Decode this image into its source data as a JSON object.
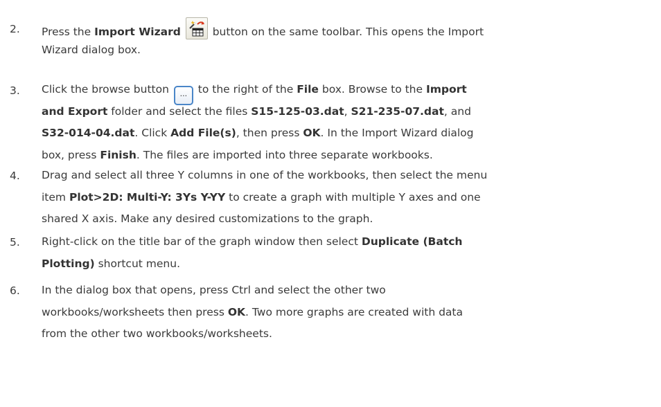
{
  "steps": [
    {
      "number": "2.",
      "line1": {
        "t1": "Press the ",
        "b1": "Import Wizard",
        "t2": " button on the same toolbar. This opens the Import"
      },
      "line2": {
        "t1": "Wizard dialog box."
      },
      "icon": "import-wizard-icon"
    },
    {
      "number": "3.",
      "line1": {
        "t1": "Click the browse button ",
        "t2": " to the right of the ",
        "b1": "File",
        "t3": " box. Browse to the ",
        "b2": "Import"
      },
      "line2": {
        "b1": "and Export",
        "t1": " folder and select the files ",
        "b2": "S15-125-03.dat",
        "t2": ", ",
        "b3": "S21-235-07.dat",
        "t3": ", and"
      },
      "line3": {
        "b1": "S32-014-04.dat",
        "t1": ". Click ",
        "b2": "Add File(s)",
        "t2": ", then press ",
        "b3": "OK",
        "t3": ". In the Import Wizard dialog"
      },
      "line4": {
        "t1": "box, press ",
        "b1": "Finish",
        "t2": ". The files are imported into three separate workbooks."
      },
      "browse_glyph": "...",
      "icon": "browse-icon"
    },
    {
      "number": "4.",
      "line1": {
        "t1": "Drag and select all three Y columns in one of the workbooks, then select the menu"
      },
      "line2": {
        "t1": "item ",
        "b1": "Plot>2D: Multi-Y: 3Ys Y-YY",
        "t2": " to create a graph with multiple Y axes and one"
      },
      "line3": {
        "t1": "shared X axis. Make any desired customizations to the graph."
      }
    },
    {
      "number": "5.",
      "line1": {
        "t1": "Right-click on the title bar of the graph window then select ",
        "b1": "Duplicate (Batch"
      },
      "line2": {
        "b1": "Plotting)",
        "t1": " shortcut menu."
      }
    },
    {
      "number": "6.",
      "line1": {
        "t1": "In the dialog box that opens, press Ctrl and select the other two"
      },
      "line2": {
        "t1": "workbooks/worksheets then press ",
        "b1": "OK",
        "t2": ". Two more graphs are created with data"
      },
      "line3": {
        "t1": "from the other two workbooks/worksheets."
      }
    }
  ],
  "colors": {
    "text": "#3a3a3a",
    "browse_border": "#4a86c8",
    "wizard_arrow": "#d9381e"
  }
}
